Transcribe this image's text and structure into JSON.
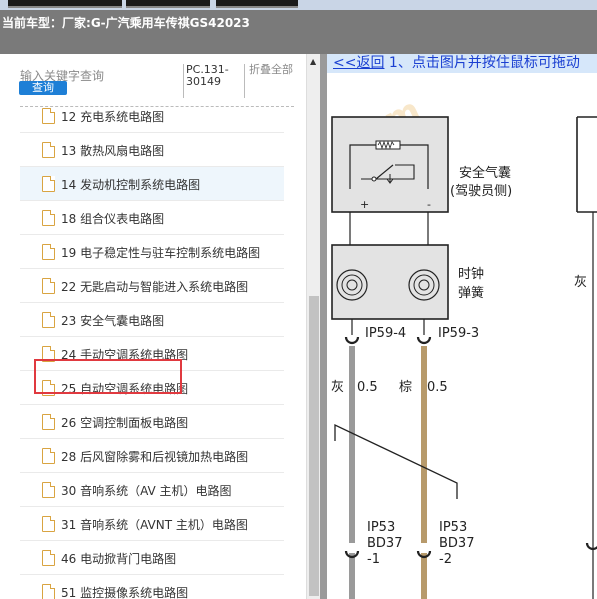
{
  "header": {
    "model_label": "当前车型：",
    "model_value": "厂家:G-广汽乘用车传祺GS42023"
  },
  "search": {
    "placeholder": "输入关键字查询",
    "button": "查询"
  },
  "info": {
    "code": "PC.131-30149",
    "fold": "折叠全部"
  },
  "tree": {
    "items": [
      {
        "label": "12 充电系统电路图"
      },
      {
        "label": "13 散热风扇电路图"
      },
      {
        "label": "14 发动机控制系统电路图"
      },
      {
        "label": "18 组合仪表电路图"
      },
      {
        "label": "19 电子稳定性与驻车控制系统电路图"
      },
      {
        "label": "22 无匙启动与智能进入系统电路图"
      },
      {
        "label": "23 安全气囊电路图"
      },
      {
        "label": "24 手动空调系统电路图"
      },
      {
        "label": "25 自动空调系统电路图"
      },
      {
        "label": "26 空调控制面板电路图"
      },
      {
        "label": "28 后风窗除雾和后视镜加热电路图"
      },
      {
        "label": "30 音响系统（AV 主机）电路图"
      },
      {
        "label": "31 音响系统（AVNT 主机）电路图"
      },
      {
        "label": "46 电动掀背门电路图"
      },
      {
        "label": "51 监控摄像系统电路图"
      }
    ],
    "highlighted_index": 2,
    "selected_index": 6
  },
  "viewer": {
    "back": "<<返回",
    "tip": " 1、点击图片并按住鼠标可拖动"
  },
  "diagram": {
    "airbag_label_1": "安全气囊",
    "airbag_label_2": "(驾驶员侧)",
    "plus": "+",
    "minus": "-",
    "clock_label_1": "时钟",
    "clock_label_2": "弹簧",
    "pin_left": "IP59-4",
    "pin_right": "IP59-3",
    "wire_left_color": "灰",
    "wire_left_size": "0.5",
    "wire_right_color": "棕",
    "wire_right_size": "0.5",
    "conn_left_1": "IP53",
    "conn_left_2": "BD37",
    "conn_left_3": "-1",
    "conn_right_1": "IP53",
    "conn_right_2": "BD37",
    "conn_right_3": "-2",
    "far_right_label": "灰",
    "wire_gray": "#9a9a9a",
    "wire_brown": "#b79a6b"
  }
}
